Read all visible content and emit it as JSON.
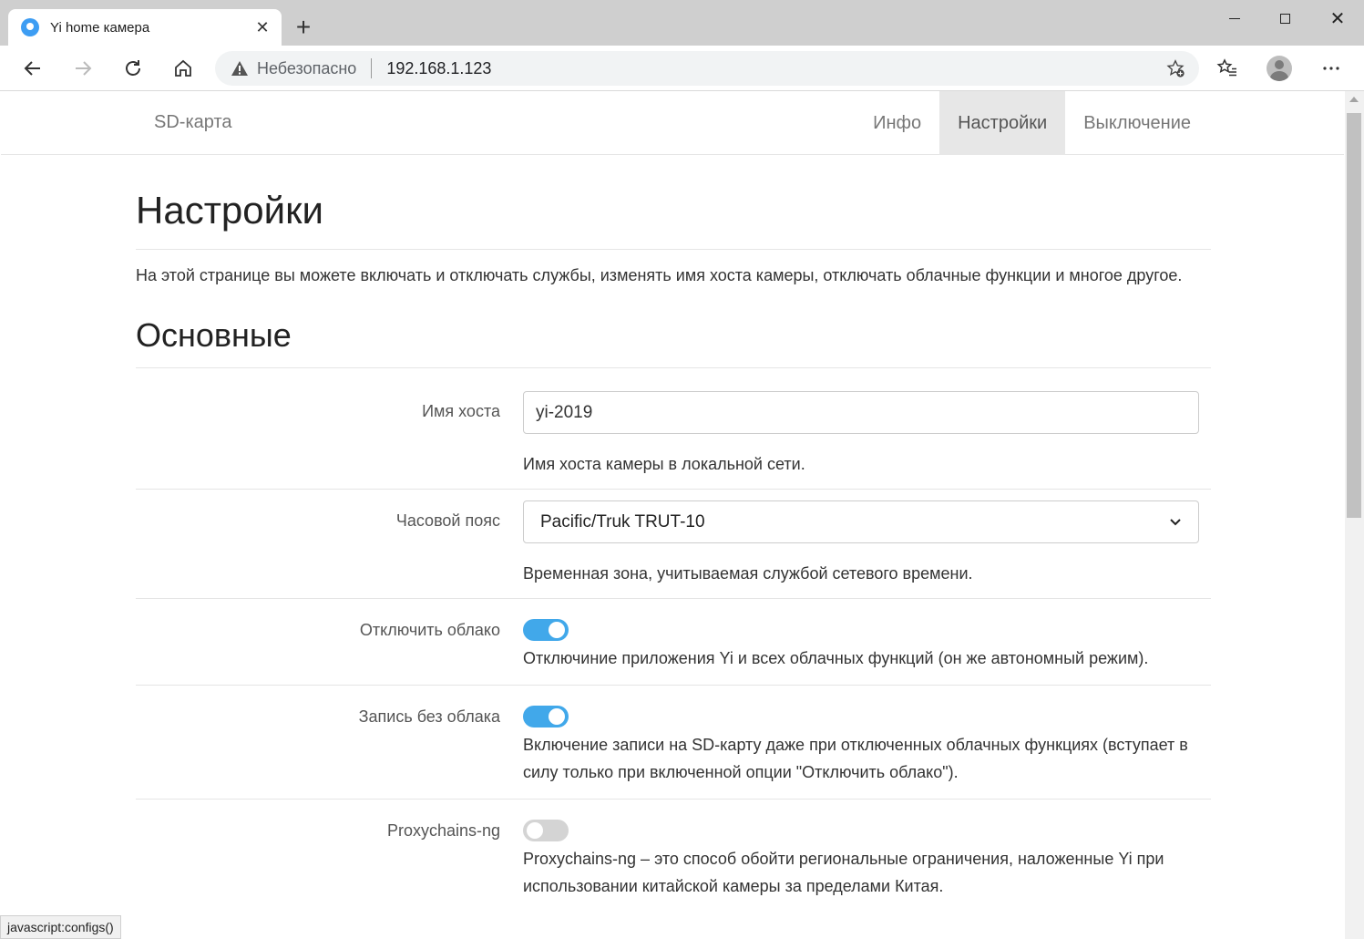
{
  "browser": {
    "tab_title": "Yi home камера",
    "tab_close": "✕",
    "new_tab": "+",
    "security_label": "Небезопасно",
    "url": "192.168.1.123",
    "status_url": "javascript:configs()"
  },
  "nav": {
    "brand": "SD-карта",
    "links": [
      "Инфо",
      "Настройки",
      "Выключение"
    ],
    "active": "Настройки"
  },
  "page": {
    "title": "Настройки",
    "intro": "На этой странице вы можете включать и отключать службы, изменять имя хоста камеры, отключать облачные функции и многое другое.",
    "section_title": "Основные"
  },
  "settings": {
    "hostname": {
      "label": "Имя хоста",
      "value": "yi-2019",
      "help": "Имя хоста камеры в локальной сети."
    },
    "timezone": {
      "label": "Часовой пояс",
      "value": "Pacific/Truk TRUT-10",
      "help": "Временная зона, учитываемая службой сетевого времени."
    },
    "disable_cloud": {
      "label": "Отключить облако",
      "enabled": true,
      "help": "Отключиние приложения Yi и всех облачных функций (он же автономный режим)."
    },
    "record_without_cloud": {
      "label": "Запись без облака",
      "enabled": true,
      "help": "Включение записи на SD-карту даже при отключенных облачных функциях (вступает в силу только при включенной опции \"Отключить облако\")."
    },
    "proxychains": {
      "label": "Proxychains-ng",
      "enabled": false,
      "help": "Proxychains-ng – это способ обойти региональные ограничения, наложенные Yi при использовании китайской камеры за пределами Китая."
    }
  },
  "colors": {
    "toggle_on": "#41a8ea",
    "toggle_off": "#d4d4d4",
    "nav_active_bg": "#e7e7e7"
  },
  "icons": [
    "favicon-camera-icon",
    "close-icon",
    "plus-icon",
    "back-icon",
    "forward-icon",
    "reload-icon",
    "home-icon",
    "warning-icon",
    "add-favorite-icon",
    "favorites-icon",
    "profile-icon",
    "more-icon",
    "chevron-down-icon"
  ]
}
